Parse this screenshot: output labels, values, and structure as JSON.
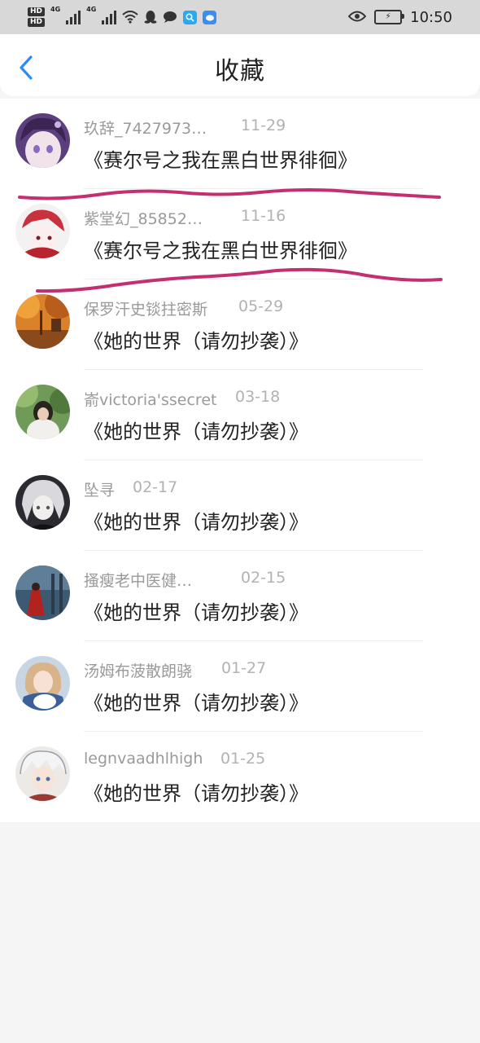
{
  "status_bar": {
    "hd1": "HD",
    "hd2": "HD",
    "net1": "4G",
    "net2": "4G",
    "time": "10:50"
  },
  "header": {
    "title": "收藏",
    "back_icon": "chevron-left-icon"
  },
  "colors": {
    "accent": "#2f8af5",
    "scribble": "#c4306f"
  },
  "items": [
    {
      "name": "玖辞_7427973…",
      "date": "11-29",
      "book": "《赛尔号之我在黑白世界徘徊》"
    },
    {
      "name": "紫堂幻_85852…",
      "date": "11-16",
      "book": "《赛尔号之我在黑白世界徘徊》"
    },
    {
      "name": "保罗汗史锬拄密斯",
      "date": "05-29",
      "book": "《她的世界（请勿抄袭）》"
    },
    {
      "name": "嵛victoria'ssecret",
      "date": "03-18",
      "book": "《她的世界（请勿抄袭）》"
    },
    {
      "name": "坠寻",
      "date": "02-17",
      "book": "《她的世界（请勿抄袭）》"
    },
    {
      "name": "搔瘦老中医健…",
      "date": "02-15",
      "book": "《她的世界（请勿抄袭）》"
    },
    {
      "name": "汤姆布菠散朗骁",
      "date": "01-27",
      "book": "《她的世界（请勿抄袭）》"
    },
    {
      "name": "legnvaadhlhigh",
      "date": "01-25",
      "book": "《她的世界（请勿抄袭）》"
    }
  ]
}
